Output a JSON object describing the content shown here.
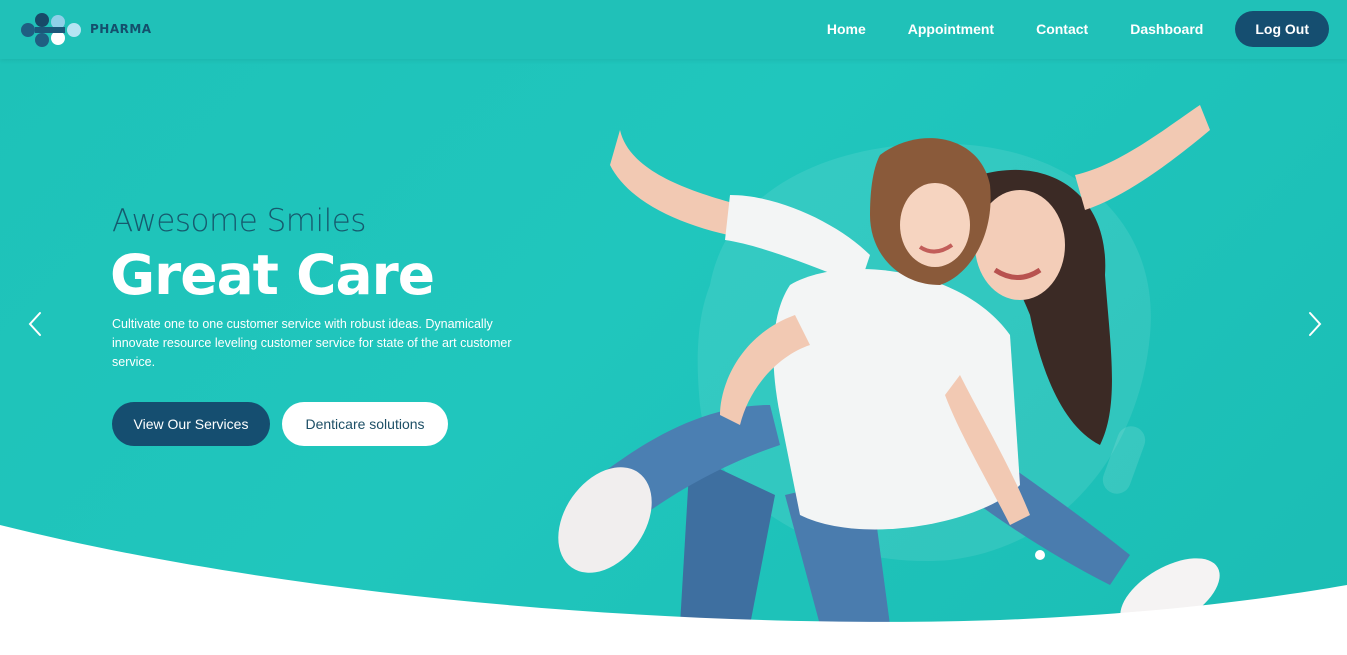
{
  "brand": {
    "name": "PHARMA"
  },
  "nav": {
    "links": [
      "Home",
      "Appointment",
      "Contact",
      "Dashboard"
    ],
    "logout_label": "Log Out"
  },
  "hero": {
    "subtitle": "Awesome Smiles",
    "title": "Great Care",
    "description": "Cultivate one to one customer service with robust ideas. Dynamically innovate resource leveling customer service for state of the art customer service.",
    "primary_button": "View Our Services",
    "secondary_button": "Denticare solutions"
  },
  "icons": {
    "prev": "chevron-left-icon",
    "next": "chevron-right-icon",
    "logo": "molecule-logo-icon"
  },
  "colors": {
    "hero_bg": "#20c1b8",
    "navy": "#154e70",
    "white": "#ffffff"
  }
}
